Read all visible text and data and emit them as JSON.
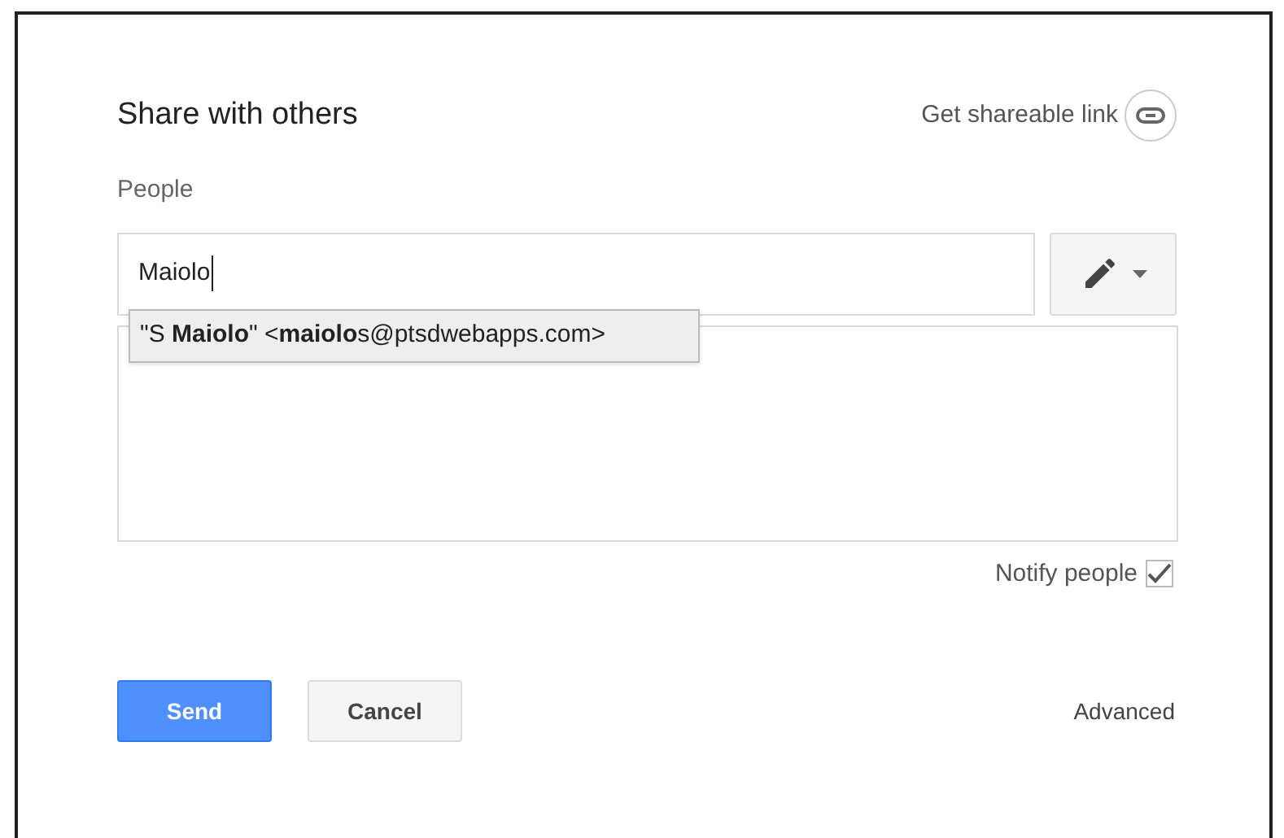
{
  "dialog": {
    "title": "Share with others",
    "shareable_link": "Get shareable link"
  },
  "people": {
    "label": "People",
    "value": "Maiolo",
    "permission_button": {
      "expanded": false
    }
  },
  "suggestion": {
    "text": "\"S **Maiolo**\" <**maiolo**s@ptsdwebapps.com>"
  },
  "notify": {
    "label": "Notify people",
    "checked": true
  },
  "buttons": [
    {
      "label": "Send",
      "kind": "primary"
    },
    {
      "label": "Cancel",
      "kind": "secondary"
    }
  ],
  "advanced": "Advanced"
}
